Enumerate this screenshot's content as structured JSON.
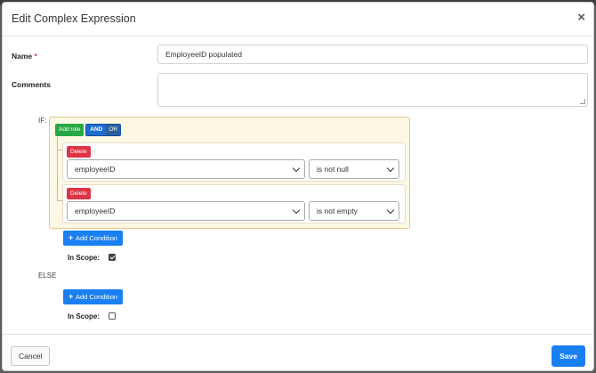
{
  "modal": {
    "title": "Edit Complex Expression",
    "close_glyph": "×"
  },
  "form": {
    "name_label": "Name",
    "required_marker": "*",
    "name_value": "EmployeeID populated",
    "comments_label": "Comments",
    "comments_value": ""
  },
  "if_block": {
    "label": "IF:",
    "add_rule_label": "Add rule",
    "and_label": "AND",
    "or_label": "OR",
    "selected_condition": "AND",
    "rules": [
      {
        "delete_label": "Delete",
        "field": "employeeID",
        "operator": "is not null"
      },
      {
        "delete_label": "Delete",
        "field": "employeeID",
        "operator": "is not empty"
      }
    ],
    "add_condition_label": "Add Condition",
    "in_scope_label": "In Scope:",
    "in_scope_checked": true
  },
  "else_block": {
    "label": "ELSE",
    "add_condition_label": "Add Condition",
    "in_scope_label": "In Scope:",
    "in_scope_checked": false
  },
  "footer": {
    "cancel_label": "Cancel",
    "save_label": "Save"
  },
  "colors": {
    "primary": "#1a7ff0",
    "success": "#28a745",
    "danger": "#dc3545",
    "group_background": "#fcf8e3",
    "group_border": "#e8c78a"
  },
  "icons": {
    "close": "close-icon",
    "plus": "plus-icon",
    "dropdown": "chevron-down-icon",
    "resize": "resize-grip-icon"
  }
}
